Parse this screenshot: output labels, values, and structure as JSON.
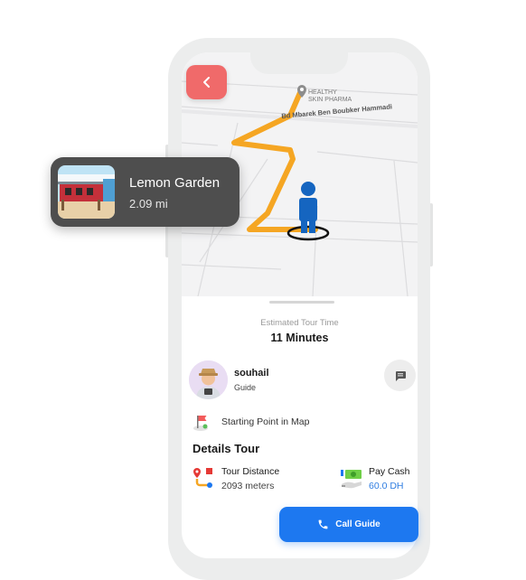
{
  "map": {
    "poi_name_line1": "HEALTHY",
    "poi_name_line2": "SKIN PHARMA",
    "road_name": "Bd Mbarek Ben Boubker Hammadi"
  },
  "place_card": {
    "name": "Lemon Garden",
    "distance": "2.09 mi"
  },
  "tour": {
    "estimated_label": "Estimated Tour Time",
    "estimated_value": "11 Minutes"
  },
  "guide": {
    "name": "souhail",
    "role": "Guide"
  },
  "starting_point": {
    "label": "Starting Point in Map"
  },
  "details": {
    "title": "Details Tour",
    "distance_label": "Tour Distance",
    "distance_value": "2093 meters",
    "payment_label": "Pay Cash",
    "payment_value": "60.0 DH"
  },
  "actions": {
    "call_label": "Call Guide"
  },
  "colors": {
    "accent": "#1d78f0",
    "back_button": "#f06a6a",
    "route": "#f5a623",
    "user_marker": "#1565c0",
    "price": "#2f7de1"
  },
  "icons": {
    "back": "chevron-left-icon",
    "message": "message-icon",
    "phone": "phone-icon",
    "pin": "map-pin-icon",
    "user": "user-location-icon",
    "start": "flag-icon",
    "distance": "route-icon",
    "payment": "cash-icon"
  }
}
